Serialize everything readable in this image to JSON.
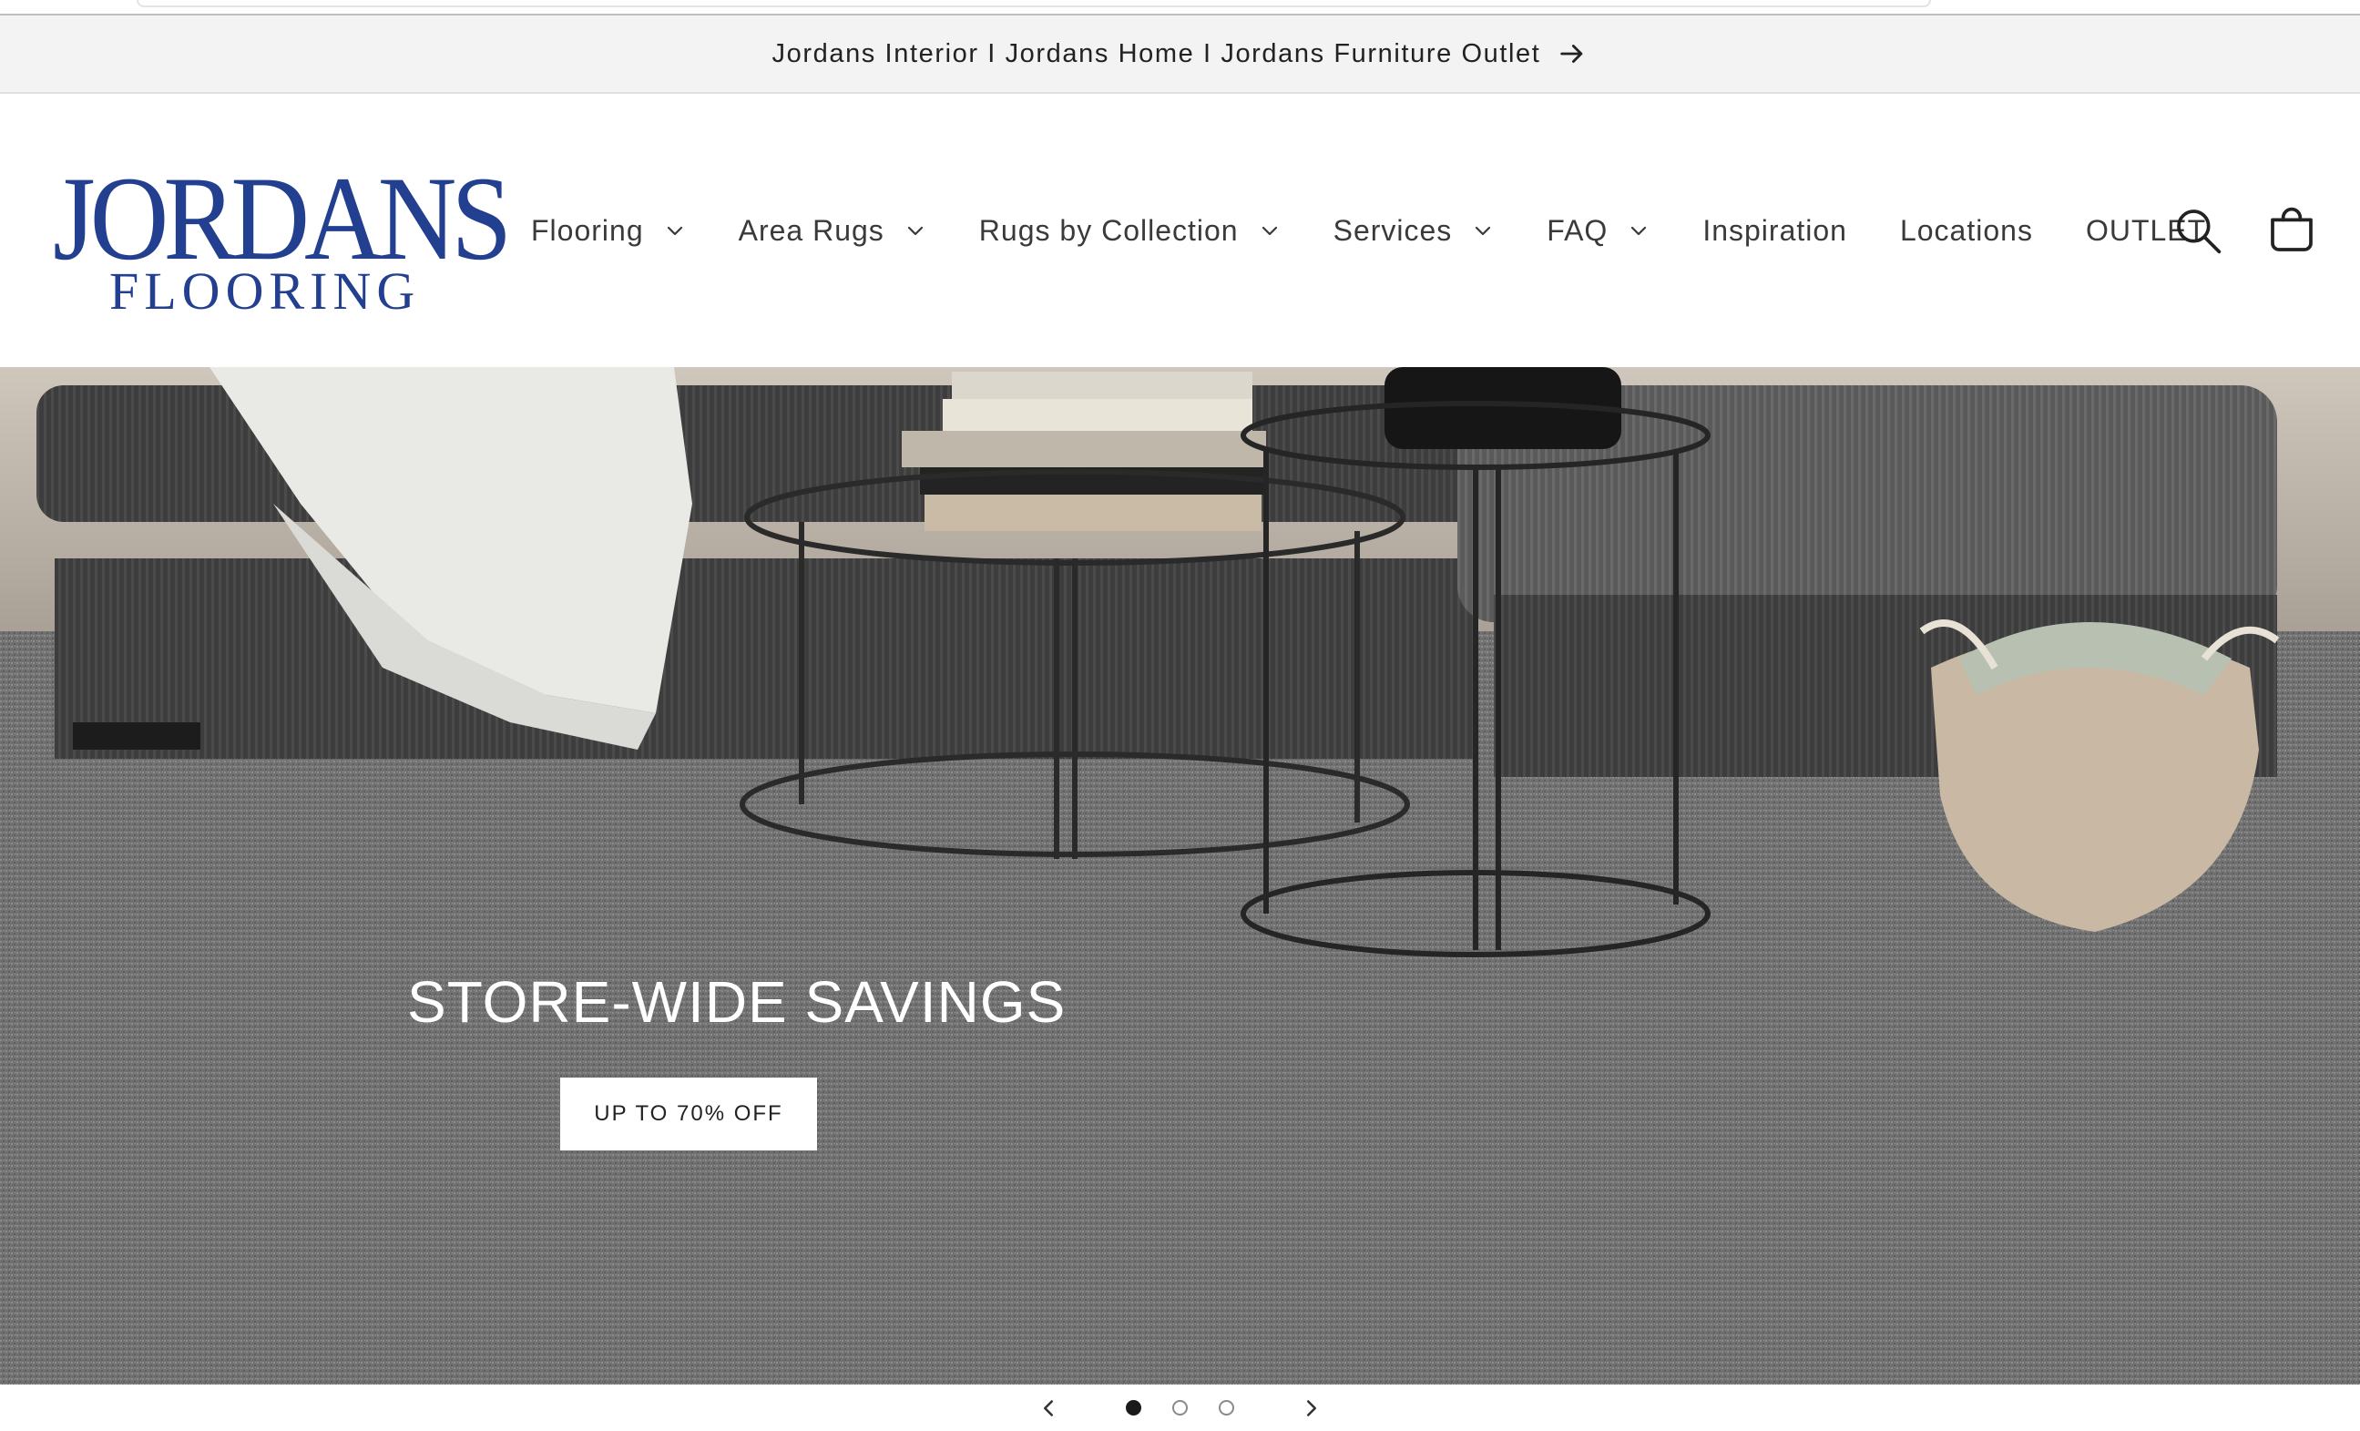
{
  "announcement": {
    "text": "Jordans Interior I Jordans Home I Jordans Furniture Outlet"
  },
  "logo": {
    "line1": "JORDANS",
    "line2": "FLOORING",
    "color": "#233f8f"
  },
  "nav": {
    "items": [
      {
        "label": "Flooring",
        "has_dropdown": true
      },
      {
        "label": "Area Rugs",
        "has_dropdown": true
      },
      {
        "label": "Rugs by Collection",
        "has_dropdown": true
      },
      {
        "label": "Services",
        "has_dropdown": true
      },
      {
        "label": "FAQ",
        "has_dropdown": true
      },
      {
        "label": "Inspiration",
        "has_dropdown": false
      },
      {
        "label": "Locations",
        "has_dropdown": false
      },
      {
        "label": "OUTLET",
        "has_dropdown": false
      }
    ]
  },
  "header_icons": {
    "search": "search-icon",
    "cart": "cart-icon"
  },
  "hero": {
    "heading": "STORE-WIDE SAVINGS",
    "button_label": "UP TO 70% OFF",
    "image": "living room with grey carpet, sofa, nesting metal side tables, woven basket"
  },
  "slider": {
    "slide_count": 3,
    "active_index": 0,
    "prev_icon": "chevron-left-icon",
    "next_icon": "chevron-right-icon"
  }
}
